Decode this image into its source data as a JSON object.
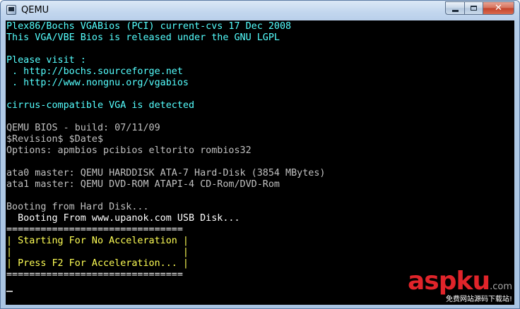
{
  "window": {
    "title": "QEMU",
    "controls": {
      "minimize_icon": "minimize-icon",
      "maximize_icon": "maximize-icon",
      "close_label": "✕"
    }
  },
  "console": {
    "lines": [
      {
        "text": "Plex86/Bochs VGABios (PCI) current-cvs 17 Dec 2008",
        "color": "#55ffff"
      },
      {
        "text": "This VGA/VBE Bios is released under the GNU LGPL",
        "color": "#55ffff"
      },
      {
        "text": "",
        "color": "#55ffff"
      },
      {
        "text": "Please visit :",
        "color": "#55ffff"
      },
      {
        "text": " . http://bochs.sourceforge.net",
        "color": "#55ffff"
      },
      {
        "text": " . http://www.nongnu.org/vgabios",
        "color": "#55ffff"
      },
      {
        "text": "",
        "color": "#55ffff"
      },
      {
        "text": "cirrus-compatible VGA is detected",
        "color": "#55ffff"
      },
      {
        "text": "",
        "color": "#c0c0c0"
      },
      {
        "text": "QEMU BIOS - build: 07/11/09",
        "color": "#c0c0c0"
      },
      {
        "text": "$Revision$ $Date$",
        "color": "#c0c0c0"
      },
      {
        "text": "Options: apmbios pcibios eltorito rombios32",
        "color": "#c0c0c0"
      },
      {
        "text": "",
        "color": "#c0c0c0"
      },
      {
        "text": "ata0 master: QEMU HARDDISK ATA-7 Hard-Disk (3854 MBytes)",
        "color": "#c0c0c0"
      },
      {
        "text": "ata1 master: QEMU DVD-ROM ATAPI-4 CD-Rom/DVD-Rom",
        "color": "#c0c0c0"
      },
      {
        "text": "",
        "color": "#c0c0c0"
      },
      {
        "text": "Booting from Hard Disk...",
        "color": "#c0c0c0"
      },
      {
        "text": "  Booting From www.upanok.com USB Disk...",
        "color": "#ffffff"
      },
      {
        "text": "===============================",
        "color": "#ffffff"
      },
      {
        "text": "| Starting For No Acceleration |",
        "color": "#ffff55"
      },
      {
        "text": "|                              |",
        "color": "#ffff55"
      },
      {
        "text": "| Press F2 For Acceleration... |",
        "color": "#ffff55"
      },
      {
        "text": "===============================",
        "color": "#ffffff"
      }
    ]
  },
  "watermark": {
    "brand_asp": "asp",
    "brand_ku": "ku",
    "brand_com": ".com",
    "subtitle": "免费网站源码下载站!"
  }
}
